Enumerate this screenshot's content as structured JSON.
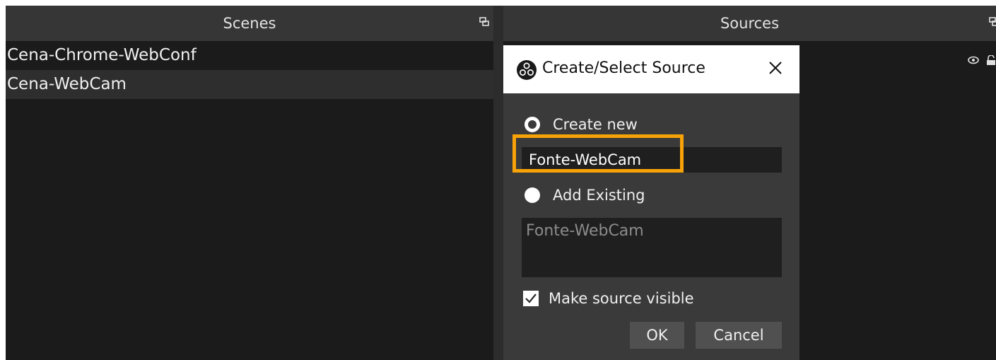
{
  "scenes_panel": {
    "title": "Scenes",
    "items": [
      {
        "label": "Cena-Chrome-WebConf"
      },
      {
        "label": "Cena-WebCam"
      }
    ]
  },
  "sources_panel": {
    "title": "Sources"
  },
  "dialog": {
    "title": "Create/Select Source",
    "create_new_label": "Create new",
    "create_new_selected": true,
    "name_input_value": "Fonte-WebCam",
    "add_existing_label": "Add Existing",
    "existing_sources": [
      "Fonte-WebCam"
    ],
    "make_visible_label": "Make source visible",
    "make_visible_checked": true,
    "ok_label": "OK",
    "cancel_label": "Cancel"
  },
  "colors": {
    "highlight": "#f7a207",
    "panel_bg": "#1b1b1b",
    "header_bg": "#363636",
    "dialog_bg": "#3a3a3a"
  },
  "icons": [
    "float-dock-icon",
    "obs-logo-icon",
    "close-icon",
    "eye-icon",
    "lock-icon",
    "checkmark-icon"
  ]
}
